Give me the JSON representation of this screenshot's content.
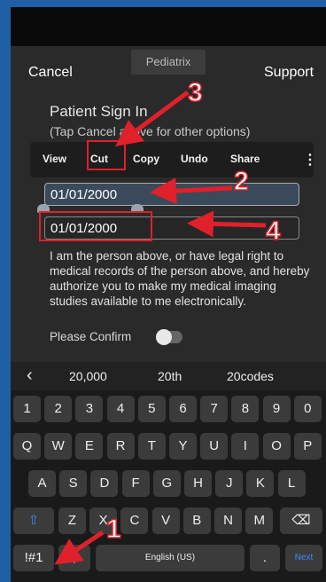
{
  "header": {
    "cancel_label": "Cancel",
    "app_title": "Pediatrix",
    "support_label": "Support"
  },
  "form": {
    "heading": "Patient Sign In",
    "subheading": "(Tap Cancel above for other options)",
    "date_value": "01/01/2000",
    "date_confirm_value": "01/01/2000",
    "consent_text": "I am the person above, or have legal right to medical records of the person above, and hereby authorize you to make my medical imaging studies available to me electronically.",
    "confirm_label": "Please Confirm"
  },
  "context_menu": {
    "items": [
      "View",
      "Cut",
      "Copy",
      "Undo",
      "Share"
    ],
    "more": "⋮"
  },
  "keyboard": {
    "suggestions": [
      "20,000",
      "20th",
      "20codes"
    ],
    "back_icon": "‹",
    "number_row": [
      "1",
      "2",
      "3",
      "4",
      "5",
      "6",
      "7",
      "8",
      "9",
      "0"
    ],
    "row1": [
      "Q",
      "W",
      "E",
      "R",
      "T",
      "Y",
      "U",
      "I",
      "O",
      "P"
    ],
    "row2": [
      "A",
      "S",
      "D",
      "F",
      "G",
      "H",
      "J",
      "K",
      "L"
    ],
    "row3": [
      "Z",
      "X",
      "C",
      "V",
      "B",
      "N",
      "M"
    ],
    "symbols_label": "!#1",
    "comma_label": ",",
    "space_label": "English (US)",
    "period_label": ".",
    "next_label": "Next",
    "shift_icon": "⇧",
    "backspace_icon": "⌫"
  },
  "annotations": {
    "callouts": [
      "1",
      "2",
      "3",
      "4"
    ],
    "color": "#e0202a"
  }
}
